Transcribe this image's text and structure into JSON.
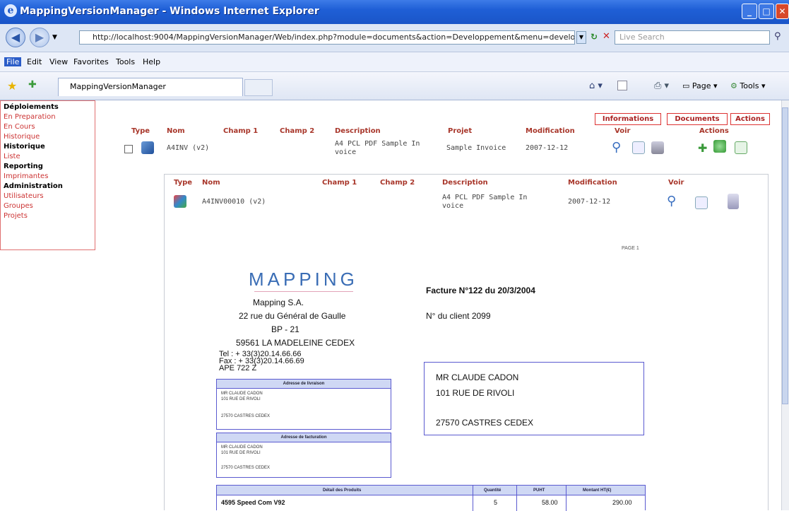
{
  "window": {
    "title": "MappingVersionManager - Windows Internet Explorer"
  },
  "browser": {
    "url": "http://localhost:9004/MappingVersionManager/Web/index.php?module=documents&action=Developpement&menu=develop",
    "search_placeholder": "Live Search",
    "menu": [
      "File",
      "Edit",
      "View",
      "Favorites",
      "Tools",
      "Help"
    ],
    "tab_label": "MappingVersionManager",
    "page_label": "Page",
    "tools_label": "Tools"
  },
  "sidebar": {
    "sections": [
      {
        "label": "Déploiements",
        "type": "heading"
      },
      {
        "label": "En Preparation",
        "type": "link"
      },
      {
        "label": "En Cours",
        "type": "link"
      },
      {
        "label": "Historique",
        "type": "link"
      },
      {
        "label": "Historique",
        "type": "heading"
      },
      {
        "label": "Liste",
        "type": "link"
      },
      {
        "label": "Reporting",
        "type": "heading"
      },
      {
        "label": "Imprimantes",
        "type": "link"
      },
      {
        "label": "Administration",
        "type": "heading"
      },
      {
        "label": "Utilisateurs",
        "type": "link"
      },
      {
        "label": "Groupes",
        "type": "link"
      },
      {
        "label": "Projets",
        "type": "link"
      }
    ]
  },
  "tabs": [
    "Informations",
    "Documents",
    "Actions"
  ],
  "main_table": {
    "headers": {
      "type": "Type",
      "nom": "Nom",
      "champ1": "Champ 1",
      "champ2": "Champ 2",
      "description": "Description",
      "projet": "Projet",
      "modification": "Modification",
      "voir": "Voir",
      "actions": "Actions"
    },
    "row": {
      "nom": "A4INV (v2)",
      "description_l1": "A4 PCL PDF Sample In",
      "description_l2": "voice",
      "projet": "Sample Invoice",
      "modification": "2007-12-12"
    }
  },
  "sub_table": {
    "headers": {
      "type": "Type",
      "nom": "Nom",
      "champ1": "Champ 1",
      "champ2": "Champ 2",
      "description": "Description",
      "modification": "Modification",
      "voir": "Voir"
    },
    "row": {
      "nom": "A4INV00010 (v2)",
      "description_l1": "A4 PCL PDF Sample In",
      "description_l2": "voice",
      "modification": "2007-12-12"
    }
  },
  "invoice": {
    "page": "PAGE 1",
    "logo": "MAPPING",
    "company": [
      "Mapping S.A.",
      "22 rue du Général de Gaulle",
      "BP - 21",
      "59561 LA MADELEINE CEDEX"
    ],
    "contact": [
      "Tel : + 33(3)20.14.66.66",
      "Fax : + 33(3)20.14.66.69",
      "APE 722 Z"
    ],
    "invoice_title": "Facture N°122 du 20/3/2004",
    "client_no": "N° du client 2099",
    "recipient": [
      "MR CLAUDE CADON",
      "101 RUE DE RIVOLI",
      "27570 CASTRES CEDEX"
    ],
    "delivery": {
      "title": "Adresse de livraison",
      "lines": [
        "MR CLAUDE CADON",
        "101 RUE DE RIVOLI",
        "27570 CASTRES CEDEX"
      ]
    },
    "billing": {
      "title": "Adresse de facturation",
      "lines": [
        "MR CLAUDE CADON",
        "101 RUE DE RIVOLI",
        "27570 CASTRES CEDEX"
      ]
    },
    "products": {
      "headers": [
        "Détail des Produits",
        "Quantité",
        "PUHT",
        "Montant HT(€)"
      ],
      "rows": [
        {
          "name": "4595 Speed Com V92",
          "qty": "5",
          "unit": "58.00",
          "total": "290.00"
        }
      ]
    }
  }
}
